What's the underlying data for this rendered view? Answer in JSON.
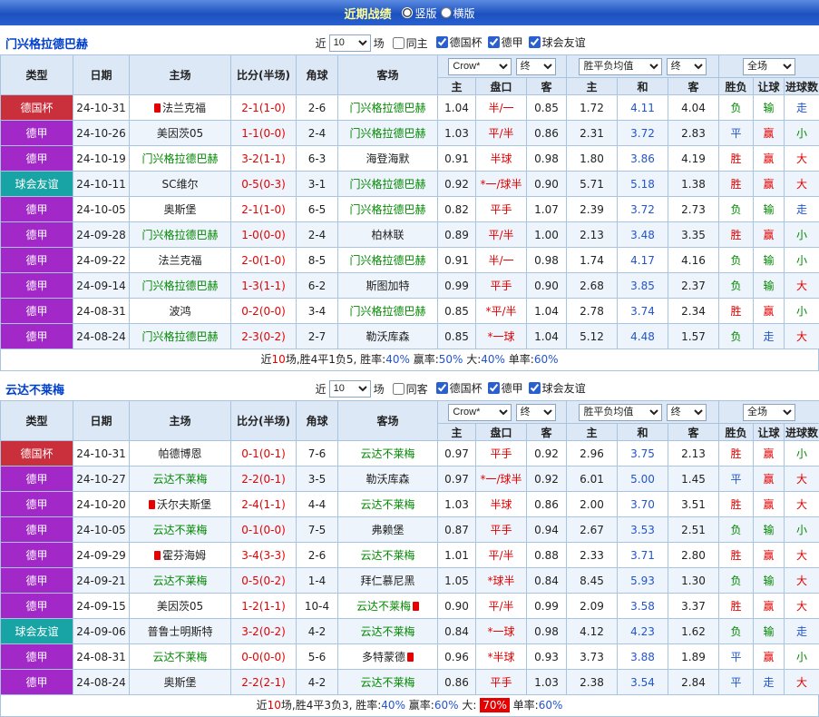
{
  "topbar": {
    "title": "近期战绩",
    "options": [
      {
        "label": "竖版",
        "selected": true
      },
      {
        "label": "横版",
        "selected": false
      }
    ]
  },
  "labels": {
    "near": "近",
    "games": "场"
  },
  "selects": {
    "company": "Crow*",
    "stage": "终",
    "europe_mean": "胜平负均值",
    "period": "全场"
  },
  "table_header": {
    "type": "类型",
    "date": "日期",
    "home": "主场",
    "score": "比分(半场)",
    "corner": "角球",
    "away": "客场",
    "asia": [
      "主",
      "盘口",
      "客"
    ],
    "europe": [
      "主",
      "和",
      "客"
    ],
    "outcome": [
      "胜负",
      "让球",
      "进球数"
    ]
  },
  "maps": {
    "type_class": {
      "德国杯": "t-cup",
      "德甲": "t-league",
      "球会友谊": "t-friendly"
    },
    "outcome_class": {
      "胜": "c-red",
      "赢": "c-red",
      "大": "c-red",
      "负": "c-green",
      "输": "c-green",
      "小": "c-green",
      "平": "c-blue",
      "走": "c-blue"
    }
  },
  "colors": {
    "type_cup": "#c9303c",
    "type_league": "#a228c8",
    "type_friendly": "#18a4a4",
    "win_red": "#e60000",
    "lose_green": "#008800",
    "draw_blue": "#2255cc",
    "topbar_blue": "#2a5fd0",
    "title_yellow": "#ffff99",
    "subject_green": "#008800"
  },
  "sections": [
    {
      "team": "门兴格拉德巴赫",
      "filter": {
        "count": "10",
        "same": "同主",
        "leagues": [
          {
            "label": "德国杯",
            "checked": true
          },
          {
            "label": "德甲",
            "checked": true
          },
          {
            "label": "球会友谊",
            "checked": true
          }
        ]
      },
      "rows": [
        {
          "type": "德国杯",
          "date": "24-10-31",
          "home": {
            "name": "法兰克福",
            "subject": false,
            "badge": "pre"
          },
          "score": "2-1(1-0)",
          "corner": "2-6",
          "away": {
            "name": "门兴格拉德巴赫",
            "subject": true,
            "badge": null
          },
          "asia": [
            "1.04",
            "半/一",
            "0.85"
          ],
          "europe": [
            "1.72",
            "4.11",
            "4.04"
          ],
          "outcome": [
            "负",
            "输",
            "走"
          ]
        },
        {
          "type": "德甲",
          "date": "24-10-26",
          "home": {
            "name": "美因茨05",
            "subject": false,
            "badge": null
          },
          "score": "1-1(0-0)",
          "corner": "2-4",
          "away": {
            "name": "门兴格拉德巴赫",
            "subject": true,
            "badge": null
          },
          "asia": [
            "1.03",
            "平/半",
            "0.86"
          ],
          "europe": [
            "2.31",
            "3.72",
            "2.83"
          ],
          "outcome": [
            "平",
            "赢",
            "小"
          ]
        },
        {
          "type": "德甲",
          "date": "24-10-19",
          "home": {
            "name": "门兴格拉德巴赫",
            "subject": true,
            "badge": null
          },
          "score": "3-2(1-1)",
          "corner": "6-3",
          "away": {
            "name": "海登海默",
            "subject": false,
            "badge": null
          },
          "asia": [
            "0.91",
            "半球",
            "0.98"
          ],
          "europe": [
            "1.80",
            "3.86",
            "4.19"
          ],
          "outcome": [
            "胜",
            "赢",
            "大"
          ]
        },
        {
          "type": "球会友谊",
          "date": "24-10-11",
          "home": {
            "name": "SC维尔",
            "subject": false,
            "badge": null
          },
          "score": "0-5(0-3)",
          "corner": "3-1",
          "away": {
            "name": "门兴格拉德巴赫",
            "subject": true,
            "badge": null
          },
          "asia": [
            "0.92",
            "*一/球半",
            "0.90"
          ],
          "europe": [
            "5.71",
            "5.18",
            "1.38"
          ],
          "outcome": [
            "胜",
            "赢",
            "大"
          ]
        },
        {
          "type": "德甲",
          "date": "24-10-05",
          "home": {
            "name": "奥斯堡",
            "subject": false,
            "badge": null
          },
          "score": "2-1(1-0)",
          "corner": "6-5",
          "away": {
            "name": "门兴格拉德巴赫",
            "subject": true,
            "badge": null
          },
          "asia": [
            "0.82",
            "平手",
            "1.07"
          ],
          "europe": [
            "2.39",
            "3.72",
            "2.73"
          ],
          "outcome": [
            "负",
            "输",
            "走"
          ]
        },
        {
          "type": "德甲",
          "date": "24-09-28",
          "home": {
            "name": "门兴格拉德巴赫",
            "subject": true,
            "badge": null
          },
          "score": "1-0(0-0)",
          "corner": "2-4",
          "away": {
            "name": "柏林联",
            "subject": false,
            "badge": null
          },
          "asia": [
            "0.89",
            "平/半",
            "1.00"
          ],
          "europe": [
            "2.13",
            "3.48",
            "3.35"
          ],
          "outcome": [
            "胜",
            "赢",
            "小"
          ]
        },
        {
          "type": "德甲",
          "date": "24-09-22",
          "home": {
            "name": "法兰克福",
            "subject": false,
            "badge": null
          },
          "score": "2-0(1-0)",
          "corner": "8-5",
          "away": {
            "name": "门兴格拉德巴赫",
            "subject": true,
            "badge": null
          },
          "asia": [
            "0.91",
            "半/一",
            "0.98"
          ],
          "europe": [
            "1.74",
            "4.17",
            "4.16"
          ],
          "outcome": [
            "负",
            "输",
            "小"
          ]
        },
        {
          "type": "德甲",
          "date": "24-09-14",
          "home": {
            "name": "门兴格拉德巴赫",
            "subject": true,
            "badge": null
          },
          "score": "1-3(1-1)",
          "corner": "6-2",
          "away": {
            "name": "斯图加特",
            "subject": false,
            "badge": null
          },
          "asia": [
            "0.99",
            "平手",
            "0.90"
          ],
          "europe": [
            "2.68",
            "3.85",
            "2.37"
          ],
          "outcome": [
            "负",
            "输",
            "大"
          ]
        },
        {
          "type": "德甲",
          "date": "24-08-31",
          "home": {
            "name": "波鸿",
            "subject": false,
            "badge": null
          },
          "score": "0-2(0-0)",
          "corner": "3-4",
          "away": {
            "name": "门兴格拉德巴赫",
            "subject": true,
            "badge": null
          },
          "asia": [
            "0.85",
            "*平/半",
            "1.04"
          ],
          "europe": [
            "2.78",
            "3.74",
            "2.34"
          ],
          "outcome": [
            "胜",
            "赢",
            "小"
          ]
        },
        {
          "type": "德甲",
          "date": "24-08-24",
          "home": {
            "name": "门兴格拉德巴赫",
            "subject": true,
            "badge": null
          },
          "score": "2-3(0-2)",
          "corner": "2-7",
          "away": {
            "name": "勒沃库森",
            "subject": false,
            "badge": null
          },
          "asia": [
            "0.85",
            "*一球",
            "1.04"
          ],
          "europe": [
            "5.12",
            "4.48",
            "1.57"
          ],
          "outcome": [
            "负",
            "走",
            "大"
          ]
        }
      ],
      "summary": [
        {
          "t": "近",
          "c": ""
        },
        {
          "t": "10",
          "c": "c-red"
        },
        {
          "t": "场,胜4平1负5, 胜率:",
          "c": ""
        },
        {
          "t": "40%",
          "c": "c-blue"
        },
        {
          "t": " 赢率:",
          "c": ""
        },
        {
          "t": "50%",
          "c": "c-blue"
        },
        {
          "t": " 大:",
          "c": ""
        },
        {
          "t": "40%",
          "c": "c-blue"
        },
        {
          "t": " 单率:",
          "c": ""
        },
        {
          "t": "60%",
          "c": "c-blue"
        }
      ]
    },
    {
      "team": "云达不莱梅",
      "filter": {
        "count": "10",
        "same": "同客",
        "leagues": [
          {
            "label": "德国杯",
            "checked": true
          },
          {
            "label": "德甲",
            "checked": true
          },
          {
            "label": "球会友谊",
            "checked": true
          }
        ]
      },
      "rows": [
        {
          "type": "德国杯",
          "date": "24-10-31",
          "home": {
            "name": "帕德博恩",
            "subject": false,
            "badge": null
          },
          "score": "0-1(0-1)",
          "corner": "7-6",
          "away": {
            "name": "云达不莱梅",
            "subject": true,
            "badge": null
          },
          "asia": [
            "0.97",
            "平手",
            "0.92"
          ],
          "europe": [
            "2.96",
            "3.75",
            "2.13"
          ],
          "outcome": [
            "胜",
            "赢",
            "小"
          ]
        },
        {
          "type": "德甲",
          "date": "24-10-27",
          "home": {
            "name": "云达不莱梅",
            "subject": true,
            "badge": null
          },
          "score": "2-2(0-1)",
          "corner": "3-5",
          "away": {
            "name": "勒沃库森",
            "subject": false,
            "badge": null
          },
          "asia": [
            "0.97",
            "*一/球半",
            "0.92"
          ],
          "europe": [
            "6.01",
            "5.00",
            "1.45"
          ],
          "outcome": [
            "平",
            "赢",
            "大"
          ]
        },
        {
          "type": "德甲",
          "date": "24-10-20",
          "home": {
            "name": "沃尔夫斯堡",
            "subject": false,
            "badge": "pre"
          },
          "score": "2-4(1-1)",
          "corner": "4-4",
          "away": {
            "name": "云达不莱梅",
            "subject": true,
            "badge": null
          },
          "asia": [
            "1.03",
            "半球",
            "0.86"
          ],
          "europe": [
            "2.00",
            "3.70",
            "3.51"
          ],
          "outcome": [
            "胜",
            "赢",
            "大"
          ]
        },
        {
          "type": "德甲",
          "date": "24-10-05",
          "home": {
            "name": "云达不莱梅",
            "subject": true,
            "badge": null
          },
          "score": "0-1(0-0)",
          "corner": "7-5",
          "away": {
            "name": "弗赖堡",
            "subject": false,
            "badge": null
          },
          "asia": [
            "0.87",
            "平手",
            "0.94"
          ],
          "europe": [
            "2.67",
            "3.53",
            "2.51"
          ],
          "outcome": [
            "负",
            "输",
            "小"
          ]
        },
        {
          "type": "德甲",
          "date": "24-09-29",
          "home": {
            "name": "霍芬海姆",
            "subject": false,
            "badge": "pre"
          },
          "score": "3-4(3-3)",
          "corner": "2-6",
          "away": {
            "name": "云达不莱梅",
            "subject": true,
            "badge": null
          },
          "asia": [
            "1.01",
            "平/半",
            "0.88"
          ],
          "europe": [
            "2.33",
            "3.71",
            "2.80"
          ],
          "outcome": [
            "胜",
            "赢",
            "大"
          ]
        },
        {
          "type": "德甲",
          "date": "24-09-21",
          "home": {
            "name": "云达不莱梅",
            "subject": true,
            "badge": null
          },
          "score": "0-5(0-2)",
          "corner": "1-4",
          "away": {
            "name": "拜仁慕尼黑",
            "subject": false,
            "badge": null
          },
          "asia": [
            "1.05",
            "*球半",
            "0.84"
          ],
          "europe": [
            "8.45",
            "5.93",
            "1.30"
          ],
          "outcome": [
            "负",
            "输",
            "大"
          ]
        },
        {
          "type": "德甲",
          "date": "24-09-15",
          "home": {
            "name": "美因茨05",
            "subject": false,
            "badge": null
          },
          "score": "1-2(1-1)",
          "corner": "10-4",
          "away": {
            "name": "云达不莱梅",
            "subject": true,
            "badge": "post"
          },
          "asia": [
            "0.90",
            "平/半",
            "0.99"
          ],
          "europe": [
            "2.09",
            "3.58",
            "3.37"
          ],
          "outcome": [
            "胜",
            "赢",
            "大"
          ]
        },
        {
          "type": "球会友谊",
          "date": "24-09-06",
          "home": {
            "name": "普鲁士明斯特",
            "subject": false,
            "badge": null
          },
          "score": "3-2(0-2)",
          "corner": "4-2",
          "away": {
            "name": "云达不莱梅",
            "subject": true,
            "badge": null
          },
          "asia": [
            "0.84",
            "*一球",
            "0.98"
          ],
          "europe": [
            "4.12",
            "4.23",
            "1.62"
          ],
          "outcome": [
            "负",
            "输",
            "走"
          ]
        },
        {
          "type": "德甲",
          "date": "24-08-31",
          "home": {
            "name": "云达不莱梅",
            "subject": true,
            "badge": null
          },
          "score": "0-0(0-0)",
          "corner": "5-6",
          "away": {
            "name": "多特蒙德",
            "subject": false,
            "badge": "post"
          },
          "asia": [
            "0.96",
            "*半球",
            "0.93"
          ],
          "europe": [
            "3.73",
            "3.88",
            "1.89"
          ],
          "outcome": [
            "平",
            "赢",
            "小"
          ]
        },
        {
          "type": "德甲",
          "date": "24-08-24",
          "home": {
            "name": "奥斯堡",
            "subject": false,
            "badge": null
          },
          "score": "2-2(2-1)",
          "corner": "4-2",
          "away": {
            "name": "云达不莱梅",
            "subject": true,
            "badge": null
          },
          "asia": [
            "0.86",
            "平手",
            "1.03"
          ],
          "europe": [
            "2.38",
            "3.54",
            "2.84"
          ],
          "outcome": [
            "平",
            "走",
            "大"
          ]
        }
      ],
      "summary": [
        {
          "t": "近",
          "c": ""
        },
        {
          "t": "10",
          "c": "c-red"
        },
        {
          "t": "场,胜4平3负3, 胜率:",
          "c": ""
        },
        {
          "t": "40%",
          "c": "c-blue"
        },
        {
          "t": " 赢率:",
          "c": ""
        },
        {
          "t": "60%",
          "c": "c-blue"
        },
        {
          "t": " 大: ",
          "c": ""
        },
        {
          "t": "70%",
          "c": "hl-red"
        },
        {
          "t": " 单率:",
          "c": ""
        },
        {
          "t": "60%",
          "c": "c-blue"
        }
      ]
    }
  ]
}
